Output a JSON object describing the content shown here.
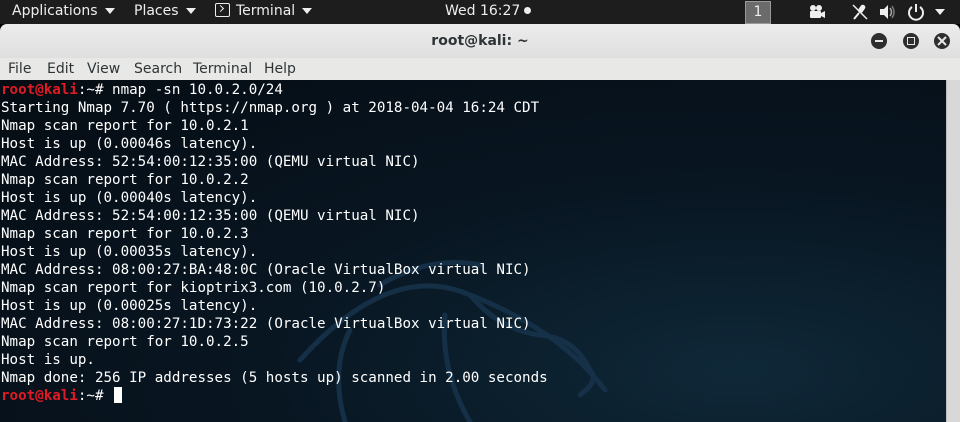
{
  "topbar": {
    "applications": "Applications",
    "places": "Places",
    "app_menu": "Terminal",
    "clock": "Wed 16:27",
    "workspace": "1",
    "icons": [
      "terminal-icon",
      "video-camera-icon",
      "microphone-off-icon",
      "volume-icon",
      "power-icon"
    ]
  },
  "window": {
    "title": "root@kali: ~",
    "buttons": [
      "minimize-icon",
      "maximize-icon",
      "close-icon"
    ]
  },
  "menubar": {
    "items": [
      "File",
      "Edit",
      "View",
      "Search",
      "Terminal",
      "Help"
    ]
  },
  "colors": {
    "prompt_user": "#e01b24",
    "terminal_bg": "#081622",
    "topbar_bg": "#1d1d1d"
  },
  "terminal": {
    "prompt_user": "root@kali",
    "prompt_path": ":~# ",
    "command": "nmap -sn 10.0.2.0/24",
    "output": [
      "Starting Nmap 7.70 ( https://nmap.org ) at 2018-04-04 16:24 CDT",
      "Nmap scan report for 10.0.2.1",
      "Host is up (0.00046s latency).",
      "MAC Address: 52:54:00:12:35:00 (QEMU virtual NIC)",
      "Nmap scan report for 10.0.2.2",
      "Host is up (0.00040s latency).",
      "MAC Address: 52:54:00:12:35:00 (QEMU virtual NIC)",
      "Nmap scan report for 10.0.2.3",
      "Host is up (0.00035s latency).",
      "MAC Address: 08:00:27:BA:48:0C (Oracle VirtualBox virtual NIC)",
      "Nmap scan report for kioptrix3.com (10.0.2.7)",
      "Host is up (0.00025s latency).",
      "MAC Address: 08:00:27:1D:73:22 (Oracle VirtualBox virtual NIC)",
      "Nmap scan report for 10.0.2.5",
      "Host is up.",
      "Nmap done: 256 IP addresses (5 hosts up) scanned in 2.00 seconds"
    ]
  }
}
